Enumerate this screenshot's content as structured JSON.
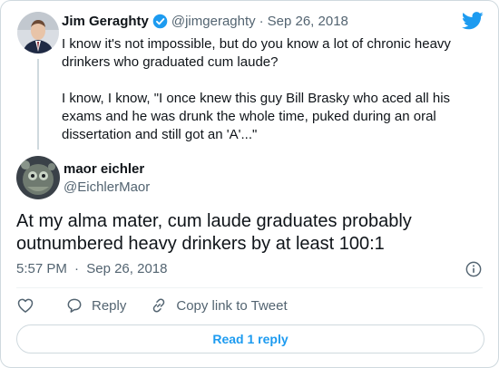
{
  "reply_tweet": {
    "author_name": "Jim Geraghty",
    "author_handle": "@jimgeraghty",
    "separator": "·",
    "date": "Sep 26, 2018",
    "paragraphs": [
      "I know it's not impossible, but do you know a lot of chronic heavy drinkers who graduated cum laude?",
      "I know, I know, \"I once knew this guy Bill Brasky who aced all his exams and he was drunk the whole time, puked during an oral dissertation and still got an 'A'...\""
    ]
  },
  "main_tweet": {
    "author_name": "maor eichler",
    "author_handle": "@EichlerMaor",
    "text": "At my alma mater, cum laude graduates probably outnumbered heavy drinkers by at least 100:1",
    "time": "5:57 PM",
    "separator": "·",
    "date": "Sep 26, 2018"
  },
  "actions": {
    "like_icon": "heart-icon",
    "reply_label": "Reply",
    "reply_icon": "speech-bubble-icon",
    "copy_label": "Copy link to Tweet",
    "copy_icon": "link-icon"
  },
  "read_replies_label": "Read 1 reply",
  "icons": {
    "brand": "twitter-bird-icon",
    "verified": "verified-badge-icon",
    "info": "info-icon"
  },
  "colors": {
    "accent": "#1d9bf0",
    "text": "#0f1419",
    "muted": "#536471",
    "border": "#cfd9de"
  }
}
